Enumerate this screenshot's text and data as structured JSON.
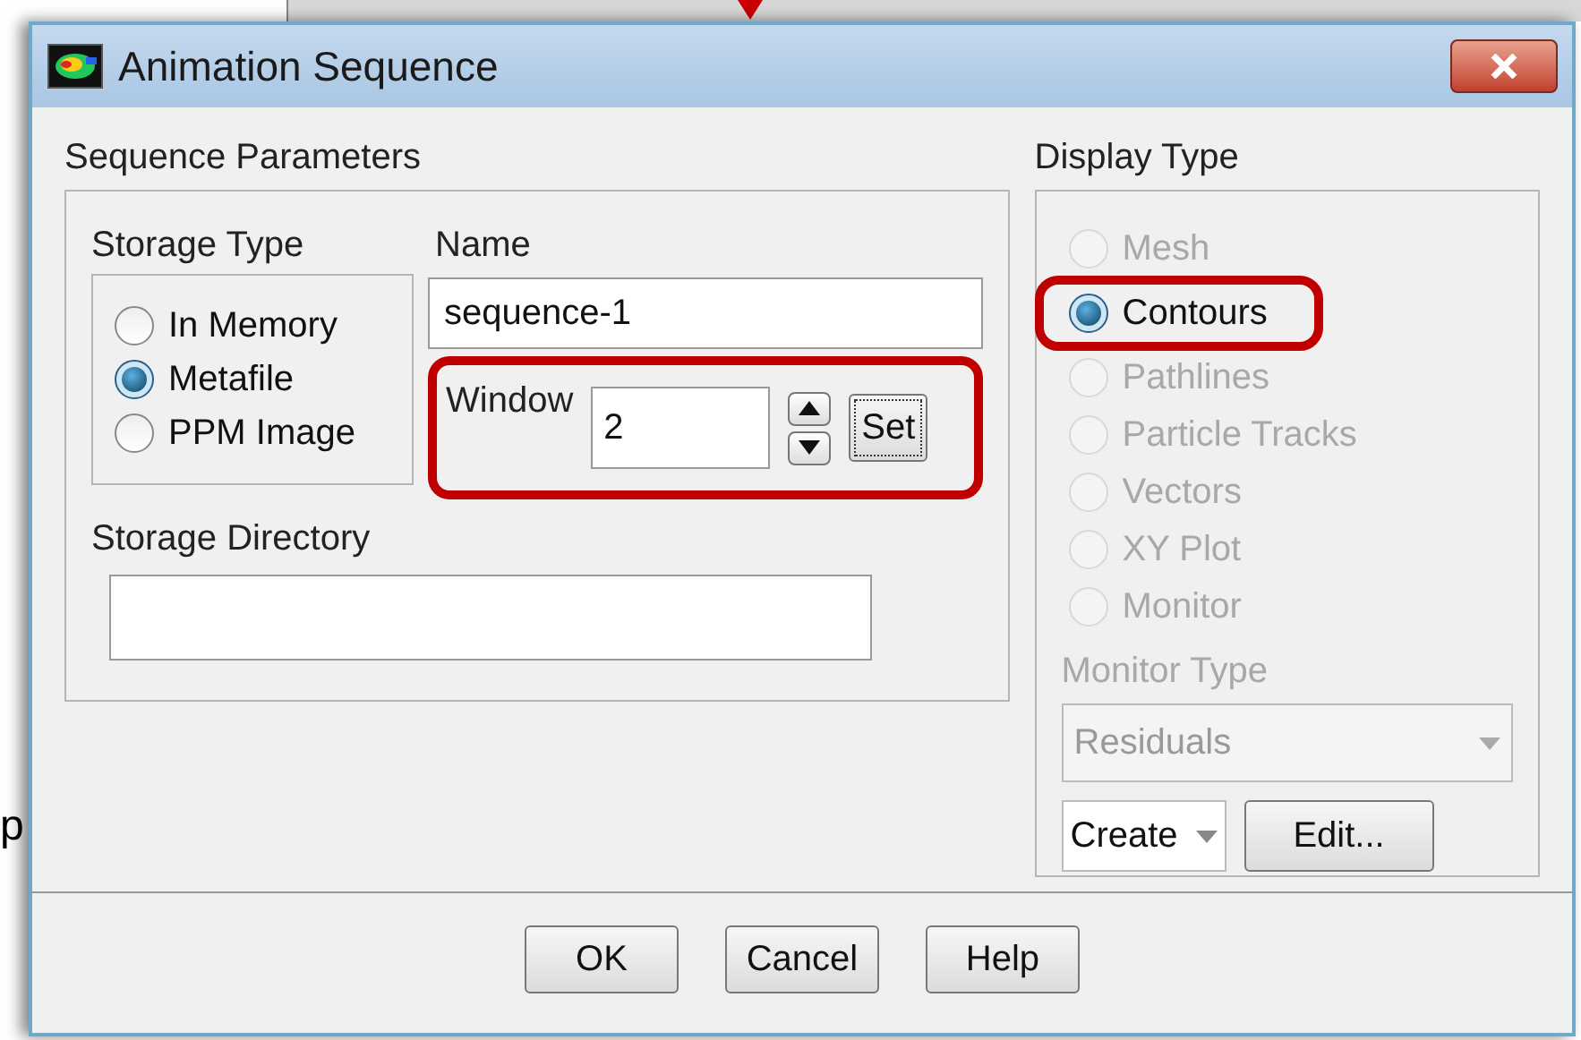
{
  "background": {
    "text": "p"
  },
  "window": {
    "title": "Animation Sequence"
  },
  "sequence_parameters": {
    "title": "Sequence Parameters",
    "storage_type": {
      "title": "Storage Type",
      "options": [
        {
          "label": "In Memory",
          "selected": false
        },
        {
          "label": "Metafile",
          "selected": true
        },
        {
          "label": "PPM Image",
          "selected": false
        }
      ]
    },
    "name": {
      "label": "Name",
      "value": "sequence-1"
    },
    "window_field": {
      "label": "Window",
      "value": "2",
      "button": "Set",
      "highlighted": true
    },
    "storage_directory": {
      "label": "Storage Directory"
    }
  },
  "display_type": {
    "title": "Display Type",
    "options": [
      {
        "label": "Mesh",
        "selected": false,
        "disabled": true,
        "highlighted": false
      },
      {
        "label": "Contours",
        "selected": true,
        "disabled": false,
        "highlighted": true
      },
      {
        "label": "Pathlines",
        "selected": false,
        "disabled": true,
        "highlighted": false
      },
      {
        "label": "Particle Tracks",
        "selected": false,
        "disabled": true,
        "highlighted": false
      },
      {
        "label": "Vectors",
        "selected": false,
        "disabled": true,
        "highlighted": false
      },
      {
        "label": "XY Plot",
        "selected": false,
        "disabled": true,
        "highlighted": false
      },
      {
        "label": "Monitor",
        "selected": false,
        "disabled": true,
        "highlighted": false
      }
    ],
    "monitor_type": {
      "label": "Monitor Type",
      "value": "Residuals",
      "disabled": true
    },
    "create": "Create",
    "edit": "Edit..."
  },
  "buttons": [
    "OK",
    "Cancel",
    "Help"
  ]
}
